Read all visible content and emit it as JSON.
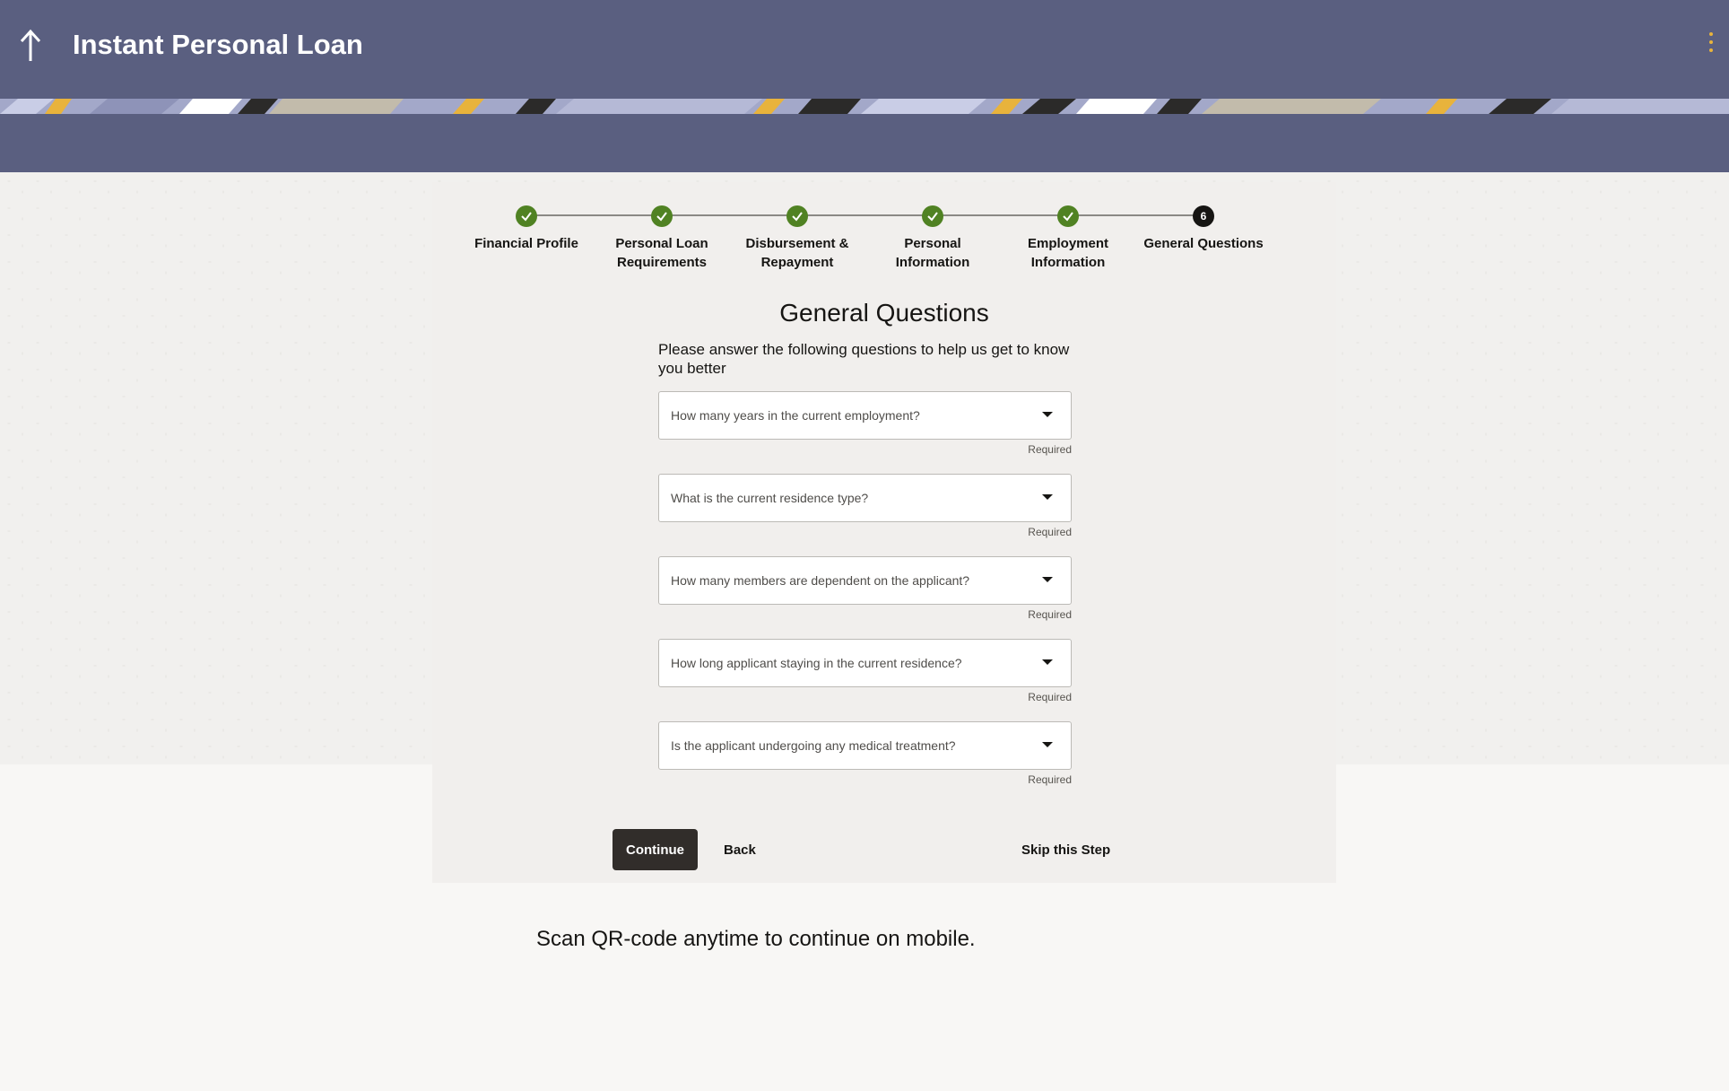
{
  "header": {
    "title": "Instant Personal Loan",
    "back_icon": "up-arrow-icon",
    "menu_icon": "kebab-menu-icon",
    "color": "#5a5f80"
  },
  "stepper": {
    "steps": [
      {
        "label_line1": "Financial Profile",
        "label_line2": "",
        "status": "complete"
      },
      {
        "label_line1": "Personal Loan",
        "label_line2": "Requirements",
        "status": "complete"
      },
      {
        "label_line1": "Disbursement &",
        "label_line2": "Repayment",
        "status": "complete"
      },
      {
        "label_line1": "Personal",
        "label_line2": "Information",
        "status": "complete"
      },
      {
        "label_line1": "Employment",
        "label_line2": "Information",
        "status": "complete"
      },
      {
        "label_line1": "General Questions",
        "label_line2": "",
        "status": "current",
        "number": "6"
      }
    ],
    "complete_color": "#508223"
  },
  "section": {
    "title": "General Questions",
    "description": "Please answer the following questions to help us get to know you better"
  },
  "questions": [
    {
      "placeholder": "How many years in the current employment?",
      "hint": "Required"
    },
    {
      "placeholder": "What is the current residence type?",
      "hint": "Required"
    },
    {
      "placeholder": "How many members are dependent on the applicant?",
      "hint": "Required"
    },
    {
      "placeholder": "How long applicant staying in the current residence?",
      "hint": "Required"
    },
    {
      "placeholder": "Is the applicant undergoing any medical treatment?",
      "hint": "Required"
    }
  ],
  "actions": {
    "continue": "Continue",
    "back": "Back",
    "skip": "Skip this Step"
  },
  "footer": {
    "qr_text": "Scan QR-code anytime to continue on mobile."
  }
}
